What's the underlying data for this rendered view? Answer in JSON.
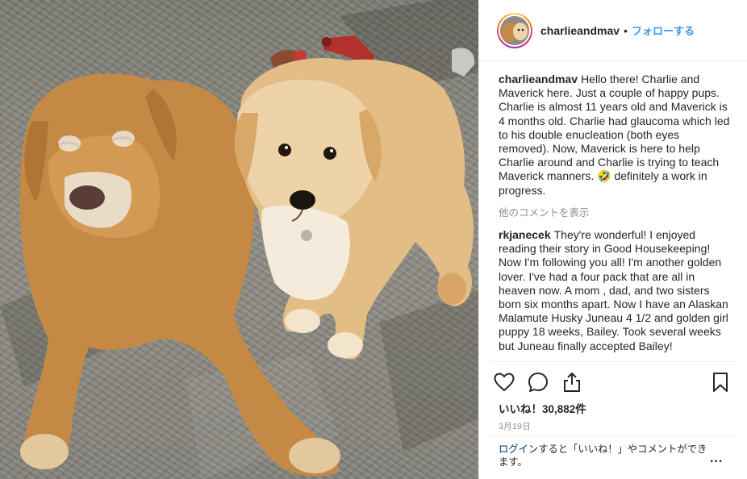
{
  "post": {
    "username": "charlieandmav",
    "dot": "•",
    "follow_label": "フォローする"
  },
  "photo": {
    "icon": "dog-photo"
  },
  "comments": [
    {
      "user": "charlieandmav",
      "text": "Hello there! Charlie and Maverick here. Just a couple of happy pups. Charlie is almost 11 years old and Maverick is 4 months old. Charlie had glaucoma which led to his double enucleation (both eyes removed). Now, Maverick is here to help Charlie around and Charlie is trying to teach Maverick manners. 🤣 definitely a work in progress."
    },
    {
      "user": "rkjanecek",
      "text": "They're wonderful! I enjoyed reading their story in Good Housekeeping! Now I'm following you all! I'm another golden lover. I've had a four pack that are all in heaven now. A mom , dad, and two sisters born six months apart. Now I have an Alaskan Malamute Husky Juneau 4 1/2 and golden girl puppy 18 weeks, Bailey. Took several weeks but Juneau finally accepted Bailey!"
    }
  ],
  "more_comments_label": "他のコメントを表示",
  "actions": {
    "like_icon": "heart-icon",
    "comment_icon": "comment-icon",
    "share_icon": "share-icon",
    "save_icon": "bookmark-icon"
  },
  "likes_label": "いいね！30,882件",
  "date_label": "3月19日",
  "footer": {
    "login_link": "ログイン",
    "login_text": "すると「いいね！」やコメントができます。",
    "more": "..."
  }
}
